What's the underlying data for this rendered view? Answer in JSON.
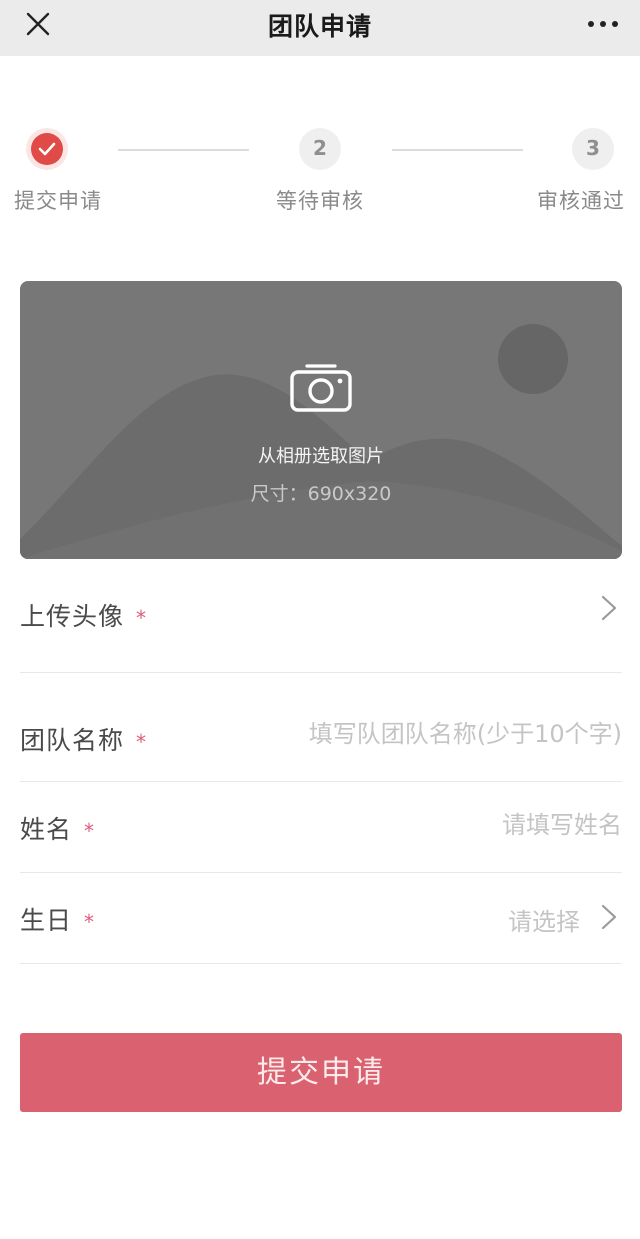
{
  "header": {
    "title": "团队申请",
    "close_icon": "close-icon",
    "more_icon": "more-icon"
  },
  "steps": [
    {
      "label": "提交申请",
      "state": "done",
      "icon": "check-icon"
    },
    {
      "label": "等待审核",
      "state": "todo",
      "number": "2"
    },
    {
      "label": "审核通过",
      "state": "todo",
      "number": "3"
    }
  ],
  "upload": {
    "text": "从相册选取图片",
    "size": "尺寸：690x320",
    "icon": "camera-icon"
  },
  "form": {
    "avatar": {
      "label": "上传头像",
      "required": "*"
    },
    "team_name": {
      "label": "团队名称",
      "required": "*",
      "placeholder": "填写队团队名称(少于10个字)"
    },
    "name": {
      "label": "姓名",
      "required": "*",
      "placeholder": "请填写姓名"
    },
    "birthday": {
      "label": "生日",
      "required": "*",
      "value": "请选择"
    }
  },
  "submit_label": "提交申请",
  "colors": {
    "accent": "#e04a47",
    "submit_bg": "#d96170",
    "required": "#e05b7e",
    "navbar_bg": "#ebebeb"
  }
}
